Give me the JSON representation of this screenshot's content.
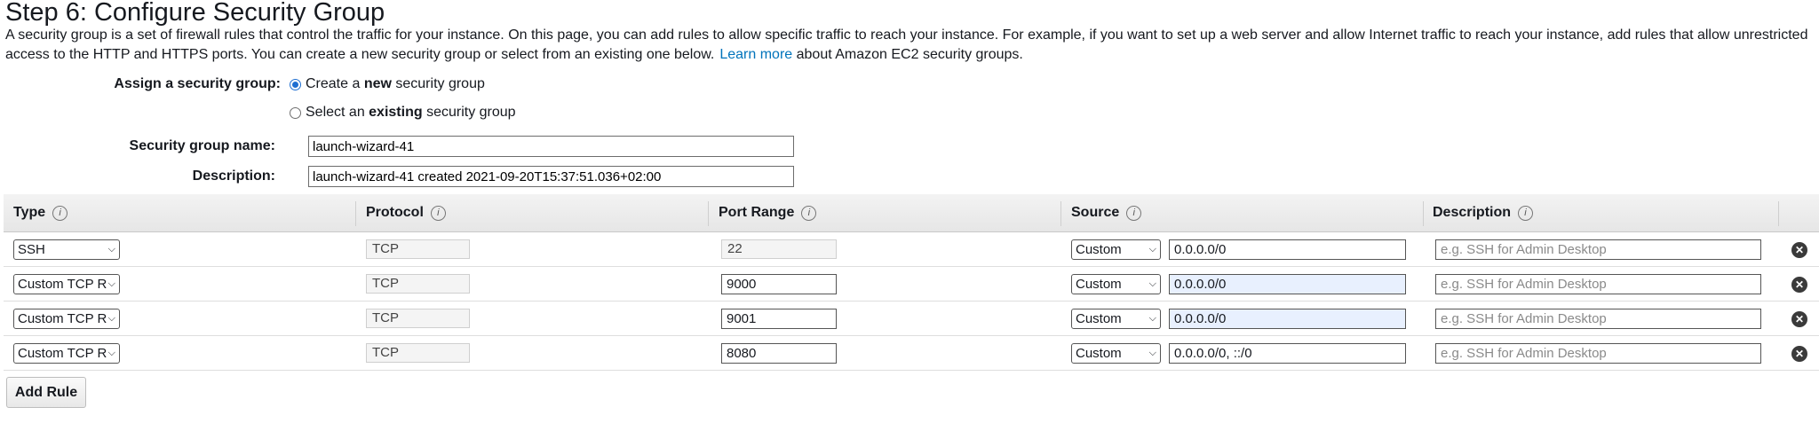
{
  "page": {
    "title": "Step 6: Configure Security Group",
    "intro_part1": "A security group is a set of firewall rules that control the traffic for your instance. On this page, you can add rules to allow specific traffic to reach your instance. For example, if you want to set up a web server and allow Internet traffic to reach your instance, add rules that allow unrestricted access to the HTTP and HTTPS ports. You can create a new security group or select from an existing one below.",
    "intro_link": "Learn more",
    "intro_part2": "about Amazon EC2 security groups."
  },
  "assign": {
    "label": "Assign a security group:",
    "option_new_pre": "Create a ",
    "option_new_bold": "new",
    "option_new_post": " security group",
    "option_existing_pre": "Select an ",
    "option_existing_bold": "existing",
    "option_existing_post": " security group",
    "selected": "new"
  },
  "group": {
    "name_label": "Security group name:",
    "name_value": "launch-wizard-41",
    "desc_label": "Description:",
    "desc_value": "launch-wizard-41 created 2021-09-20T15:37:51.036+02:00"
  },
  "table": {
    "headers": {
      "type": "Type",
      "protocol": "Protocol",
      "port_range": "Port Range",
      "source": "Source",
      "description": "Description"
    },
    "info_icon": "i",
    "rows": [
      {
        "type": "SSH",
        "protocol": "TCP",
        "port": "22",
        "source_mode": "Custom",
        "source": "0.0.0.0/0",
        "desc_placeholder": "e.g. SSH for Admin Desktop"
      },
      {
        "type": "Custom TCP R",
        "protocol": "TCP",
        "port": "9000",
        "source_mode": "Custom",
        "source": "0.0.0.0/0",
        "desc_placeholder": "e.g. SSH for Admin Desktop"
      },
      {
        "type": "Custom TCP R",
        "protocol": "TCP",
        "port": "9001",
        "source_mode": "Custom",
        "source": "0.0.0.0/0",
        "desc_placeholder": "e.g. SSH for Admin Desktop"
      },
      {
        "type": "Custom TCP R",
        "protocol": "TCP",
        "port": "8080",
        "source_mode": "Custom",
        "source": "0.0.0.0/0, ::/0",
        "desc_placeholder": "e.g. SSH for Admin Desktop"
      }
    ],
    "remove_glyph": "✕"
  },
  "actions": {
    "add_rule": "Add Rule"
  }
}
